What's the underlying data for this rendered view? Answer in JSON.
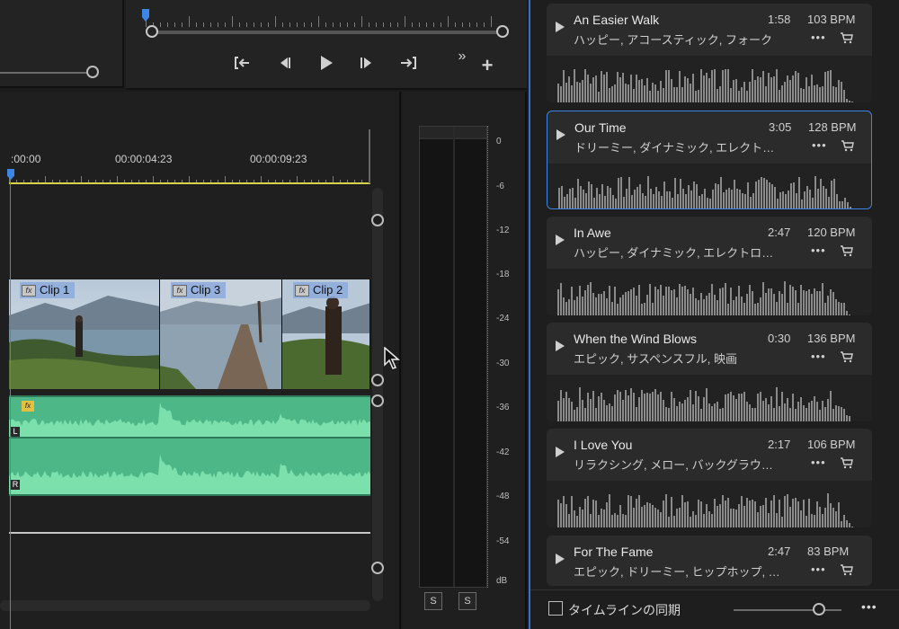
{
  "transport": {
    "icons": [
      "mark-in-icon",
      "step-back-icon",
      "play-icon",
      "step-forward-icon",
      "mark-out-icon",
      "more-controls-icon",
      "add-button-icon"
    ],
    "more_label": "»",
    "add_label": "+"
  },
  "timeline": {
    "timecodes": [
      ":00:00",
      "00:00:04:23",
      "00:00:09:23"
    ],
    "clips": [
      {
        "label": "Clip 1",
        "fx": "fx"
      },
      {
        "label": "Clip 3",
        "fx": "fx"
      },
      {
        "label": "Clip 2",
        "fx": "fx"
      }
    ],
    "audio_fx": "fx",
    "channel_left": "L",
    "channel_right": "R"
  },
  "meter": {
    "db_labels": [
      "0",
      "-6",
      "-12",
      "-18",
      "-24",
      "-30",
      "-36",
      "-42",
      "-48",
      "-54",
      "dB"
    ],
    "solo_left": "S",
    "solo_right": "S"
  },
  "music": {
    "tracks": [
      {
        "title": "An Easier Walk",
        "tags": "ハッピー, アコースティック, フォーク",
        "duration": "1:58",
        "bpm": "103 BPM",
        "selected": false
      },
      {
        "title": "Our Time",
        "tags": "ドリーミー, ダイナミック, エレクト…",
        "duration": "3:05",
        "bpm": "128 BPM",
        "selected": true
      },
      {
        "title": "In Awe",
        "tags": "ハッピー, ダイナミック, エレクトロ…",
        "duration": "2:47",
        "bpm": "120 BPM",
        "selected": false
      },
      {
        "title": "When the Wind Blows",
        "tags": "エピック, サスペンスフル, 映画",
        "duration": "0:30",
        "bpm": "136 BPM",
        "selected": false
      },
      {
        "title": "I Love You",
        "tags": "リラクシング, メロー, バックグラウ…",
        "duration": "2:17",
        "bpm": "106 BPM",
        "selected": false
      },
      {
        "title": "For The Fame",
        "tags": "エピック, ドリーミー, ヒップホップ, …",
        "duration": "2:47",
        "bpm": "83 BPM",
        "selected": false
      }
    ],
    "more_label": "•••",
    "sync_label": "タイムラインの同期",
    "footer_more": "•••"
  },
  "colors": {
    "accent": "#3e86e6",
    "audio": "#4db788",
    "waveform": "#8a8a8a",
    "timeline_marker": "#d6d24a"
  }
}
